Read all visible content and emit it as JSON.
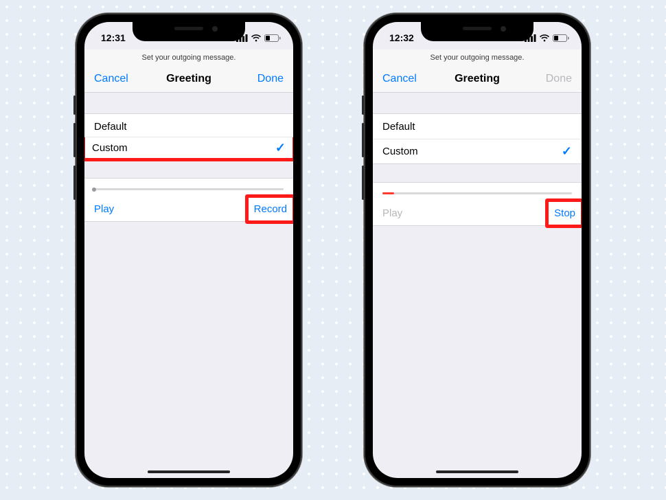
{
  "left": {
    "status": {
      "time": "12:31"
    },
    "subheader": "Set your outgoing message.",
    "nav": {
      "cancel": "Cancel",
      "title": "Greeting",
      "done": "Done",
      "done_disabled": false
    },
    "options": {
      "default": "Default",
      "custom": "Custom"
    },
    "actions": {
      "play": "Play",
      "play_disabled": false,
      "right": "Record"
    },
    "progress": {
      "fill_pct": 0,
      "show_dot": true
    },
    "highlight_custom": true,
    "highlight_right": true
  },
  "right": {
    "status": {
      "time": "12:32"
    },
    "subheader": "Set your outgoing message.",
    "nav": {
      "cancel": "Cancel",
      "title": "Greeting",
      "done": "Done",
      "done_disabled": true
    },
    "options": {
      "default": "Default",
      "custom": "Custom"
    },
    "actions": {
      "play": "Play",
      "play_disabled": true,
      "right": "Stop"
    },
    "progress": {
      "fill_pct": 6,
      "show_dot": false
    },
    "highlight_custom": false,
    "highlight_right": true
  }
}
